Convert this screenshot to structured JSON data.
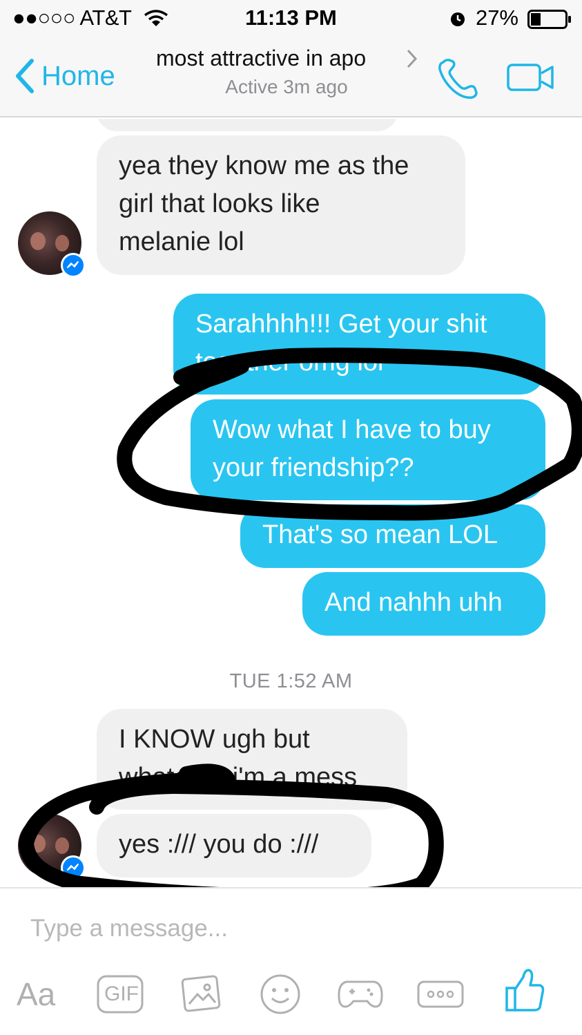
{
  "status_bar": {
    "carrier": "●●○○○ AT&T",
    "time": "11:13 PM",
    "battery": "27%",
    "icons": [
      "wifi-icon",
      "alarm-icon",
      "battery-icon"
    ]
  },
  "header": {
    "back_label": "Home",
    "title": "most attractive in apo",
    "subtitle": "Active 3m ago",
    "icons": [
      "chevron-left-icon",
      "chevron-right-icon",
      "phone-icon",
      "video-camera-icon"
    ]
  },
  "messages": [
    {
      "direction": "incoming",
      "lines": [
        "yea they know me as the",
        "girl that looks like",
        "melanie lol"
      ]
    },
    {
      "direction": "outgoing",
      "lines": [
        "Sarahhhh!!! Get your shit",
        "together omg lol"
      ]
    },
    {
      "direction": "outgoing",
      "lines": [
        "Wow what I have to buy",
        "your friendship??"
      ]
    },
    {
      "direction": "outgoing",
      "lines": [
        "That's so mean LOL"
      ]
    },
    {
      "direction": "outgoing",
      "lines": [
        "And nahhh uhh"
      ]
    },
    {
      "direction": "incoming",
      "lines": [
        "I KNOW ugh but",
        "whatever i'm a mess"
      ]
    },
    {
      "direction": "incoming",
      "lines": [
        "yes :/// you do :///"
      ]
    }
  ],
  "timestamp": "TUE 1:52 AM",
  "composer": {
    "placeholder": "Type a message...",
    "aa_label": "Aa",
    "gif_label": "GIF",
    "toolbar_icons": [
      "text-format-icon",
      "gif-icon",
      "photo-icon",
      "emoji-icon",
      "game-controller-icon",
      "more-icon",
      "thumbs-up-icon"
    ]
  },
  "colors": {
    "accent": "#1fb6e8",
    "outgoing_bubble": "#29c5f0",
    "incoming_bubble": "#f1f0f0",
    "annotation_ink": "#000000"
  }
}
